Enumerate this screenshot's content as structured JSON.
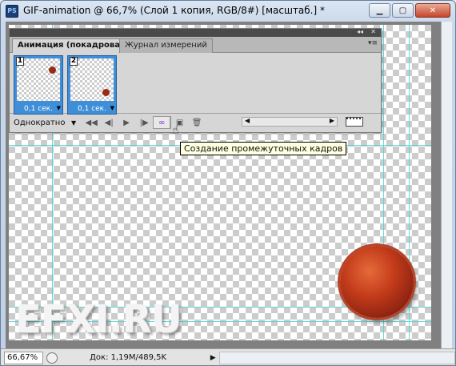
{
  "window": {
    "app_icon": "PS",
    "title": "GIF-animation @ 66,7% (Слой 1 копия, RGB/8#) [масштаб.] *",
    "minimize_icon": "minimize-icon",
    "maximize_icon": "maximize-icon",
    "close_icon": "close-icon"
  },
  "canvas": {
    "watermark": "EFXI.RU",
    "ball_color": "#c23b1a",
    "guide_color": "#48d5d5"
  },
  "panel": {
    "tabs": [
      {
        "label": "Анимация (покадровая)",
        "active": true
      },
      {
        "label": "Журнал измерений",
        "active": false
      }
    ],
    "frames": [
      {
        "number": "1",
        "delay": "0,1 сек."
      },
      {
        "number": "2",
        "delay": "0,1 сек."
      }
    ],
    "loop": "Однократно",
    "tooltip": "Создание промежуточных кадров"
  },
  "status": {
    "zoom": "66,67%",
    "doc_info": "Док: 1,19M/489,5K"
  }
}
